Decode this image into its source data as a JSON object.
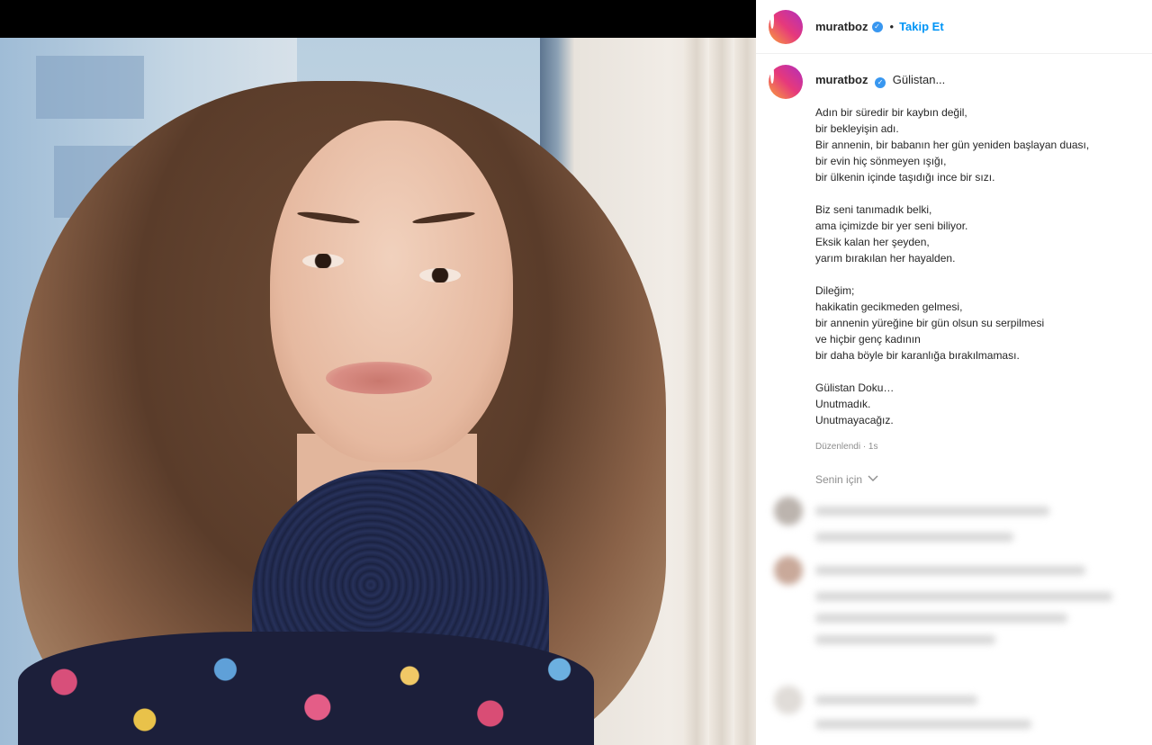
{
  "post": {
    "username": "muratboz",
    "follow_label": "Takip Et",
    "separator": "•"
  },
  "caption": {
    "username": "muratboz",
    "title": "Gülistan...",
    "stanzas": [
      [
        "Adın bir süredir bir kaybın değil,",
        "bir bekleyişin adı.",
        "Bir annenin, bir babanın her gün yeniden başlayan duası,",
        "bir evin hiç sönmeyen ışığı,",
        "bir ülkenin içinde taşıdığı ince bir sızı."
      ],
      [
        "Biz seni tanımadık belki,",
        "ama içimizde bir yer seni biliyor.",
        "Eksik kalan her şeyden,",
        "yarım bırakılan her hayalden."
      ],
      [
        "Dileğim;",
        "hakikatin gecikmeden gelmesi,",
        "bir annenin yüreğine bir gün olsun su serpilmesi",
        "ve hiçbir genç kadının",
        "bir daha böyle bir karanlığa bırakılmaması."
      ],
      [
        "Gülistan Doku…",
        "Unutmadık.",
        "Unutmayacağız."
      ]
    ],
    "meta": "Düzenlendi · 1s"
  },
  "for_you": {
    "label": "Senin için",
    "icon": "chevron-down-icon"
  },
  "colors": {
    "accent": "#0095f6",
    "verified": "#3897f0",
    "muted": "#8e8e8e"
  }
}
